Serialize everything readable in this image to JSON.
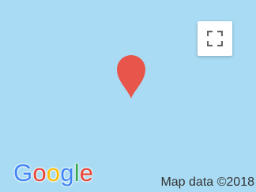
{
  "map": {
    "water_color": "#a9dcf4",
    "pin_color": "#e8554a",
    "fullscreen_icon": "fullscreen-icon",
    "pin_icon": "map-pin-icon"
  },
  "logo": {
    "letters": [
      {
        "char": "G",
        "color": "#4285f4"
      },
      {
        "char": "o",
        "color": "#ea4335"
      },
      {
        "char": "o",
        "color": "#fbbc05"
      },
      {
        "char": "g",
        "color": "#4285f4"
      },
      {
        "char": "l",
        "color": "#34a853"
      },
      {
        "char": "e",
        "color": "#ea4335"
      }
    ]
  },
  "attribution": {
    "text": "Map data ©2018"
  }
}
